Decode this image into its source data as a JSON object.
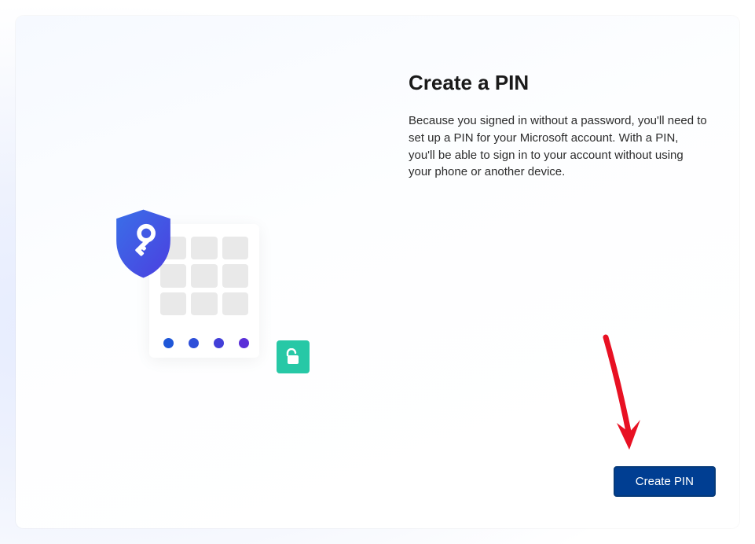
{
  "header": {
    "title": "Create a PIN"
  },
  "body": {
    "description": "Because you signed in without a password, you'll need to set up a PIN for your Microsoft account. With a PIN, you'll be able to sign in to your account without using your phone or another device."
  },
  "actions": {
    "primary_label": "Create PIN"
  },
  "illustration": {
    "shield_icon": "shield-key",
    "keypad_keys": 9,
    "pin_dots": 4,
    "badge_icon": "unlocked-padlock"
  },
  "annotation": {
    "type": "arrow",
    "color": "#e81123",
    "points_to": "Create PIN button"
  }
}
